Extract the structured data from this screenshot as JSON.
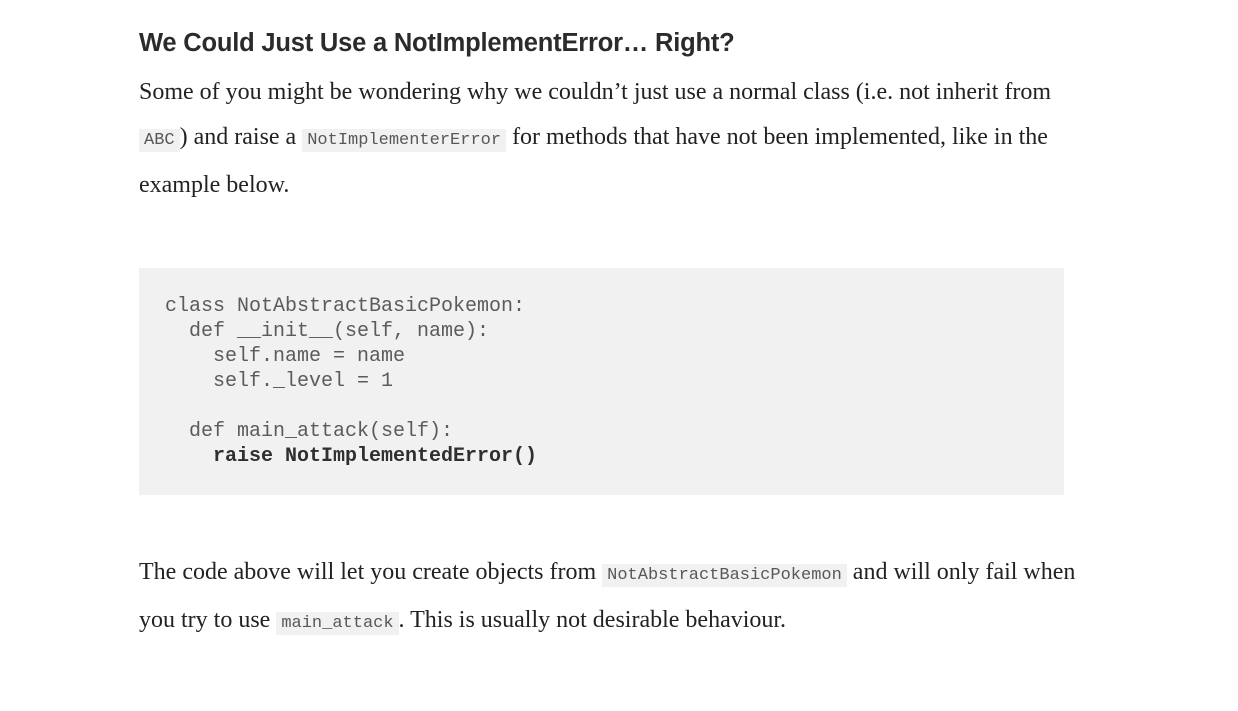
{
  "article": {
    "heading": "We Could Just Use a NotImplementError… Right?",
    "intro_paragraph": {
      "segment_1": "Some of you might be wondering why we couldn’t just use a normal class (i.e. not inherit from ",
      "code_1": "ABC",
      "segment_2": ") and raise a ",
      "code_2": "NotImplementerError",
      "segment_3": " for methods that have not been implemented, like in the example below."
    },
    "code_block": {
      "language": "python",
      "lines": [
        "class NotAbstractBasicPokemon:",
        "  def __init__(self, name):",
        "    self.name = name",
        "    self._level = 1",
        "",
        "  def main_attack(self):",
        "    raise NotImplementedError()"
      ],
      "emphasized_line_index": 6
    },
    "closing_paragraph": {
      "segment_1": "The code above will let you create objects from ",
      "code_1": "NotAbstractBasicPokemon",
      "segment_2": " and will only fail when you try to use ",
      "code_2": "main_attack",
      "segment_3": ". This is usually not desirable behaviour."
    }
  },
  "colors": {
    "page_background": "#ffffff",
    "heading_text": "#2b2b2b",
    "body_text": "#222222",
    "code_background": "#f1f1f1",
    "code_text": "#5b5b5b",
    "code_emphasis_text": "#2f2f2f",
    "inline_code_text": "#585858"
  }
}
